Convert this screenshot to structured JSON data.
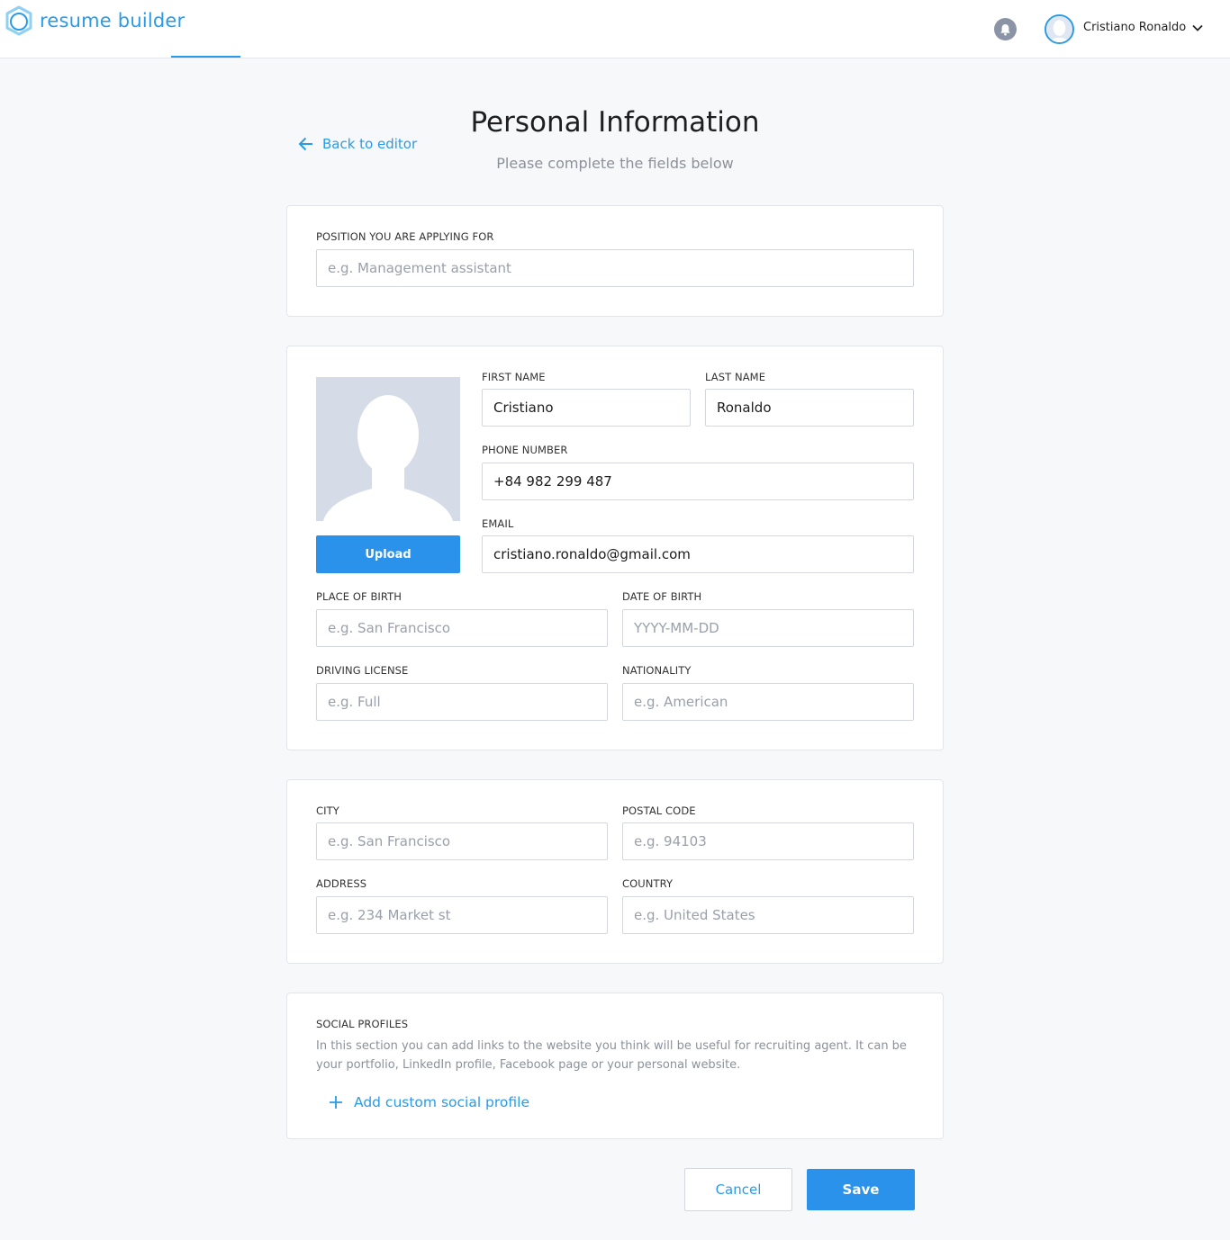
{
  "app": {
    "brand": "resume builder",
    "brand_color": "#2a9be8"
  },
  "header": {
    "notification_icon": "bell-icon",
    "user_name": "Cristiano Ronaldo",
    "menu_icon": "chevron-down-icon"
  },
  "page": {
    "back_label": "Back to editor",
    "title": "Personal Information",
    "subtitle": "Please complete the fields below"
  },
  "position": {
    "label": "POSITION YOU ARE APPLYING FOR",
    "value": "",
    "placeholder": "e.g. Management assistant"
  },
  "personal": {
    "upload_label": "Upload",
    "first_name": {
      "label": "FIRST NAME",
      "value": "Cristiano",
      "placeholder": ""
    },
    "last_name": {
      "label": "LAST NAME",
      "value": "Ronaldo",
      "placeholder": ""
    },
    "phone": {
      "label": "PHONE NUMBER",
      "value": "+84 982 299 487",
      "placeholder": ""
    },
    "email": {
      "label": "EMAIL",
      "value": "cristiano.ronaldo@gmail.com",
      "placeholder": ""
    },
    "place_of_birth": {
      "label": "PLACE OF BIRTH",
      "value": "",
      "placeholder": "e.g. San Francisco"
    },
    "date_of_birth": {
      "label": "DATE OF BIRTH",
      "value": "",
      "placeholder": "YYYY-MM-DD"
    },
    "driving_license": {
      "label": "DRIVING LICENSE",
      "value": "",
      "placeholder": "e.g. Full"
    },
    "nationality": {
      "label": "NATIONALITY",
      "value": "",
      "placeholder": "e.g. American"
    }
  },
  "address": {
    "city": {
      "label": "CITY",
      "value": "",
      "placeholder": "e.g. San Francisco"
    },
    "postal_code": {
      "label": "POSTAL CODE",
      "value": "",
      "placeholder": "e.g. 94103"
    },
    "address": {
      "label": "ADDRESS",
      "value": "",
      "placeholder": "e.g. 234 Market st"
    },
    "country": {
      "label": "COUNTRY",
      "value": "",
      "placeholder": "e.g. United States"
    }
  },
  "social": {
    "label": "SOCIAL PROFILES",
    "description": "In this section you can add links to the website you think will be useful for recruiting agent. It can be your portfolio, LinkedIn profile, Facebook page or your personal website.",
    "add_label": "Add custom social profile"
  },
  "actions": {
    "cancel_label": "Cancel",
    "save_label": "Save"
  }
}
